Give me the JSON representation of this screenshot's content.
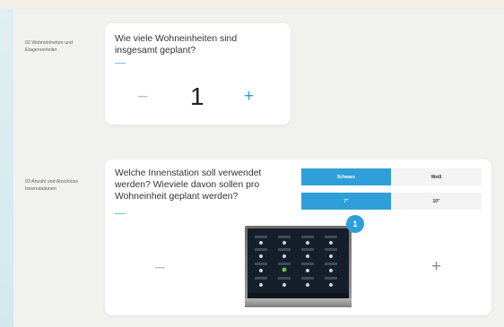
{
  "section1": {
    "label": "02 Wohneinheiten und Etagenverteiler",
    "question": "Wie viele Wohneinheiten sind insgesamt geplant?",
    "value": "1",
    "minus_symbol": "–",
    "plus_symbol": "+"
  },
  "section2": {
    "label": "03 Anzahl und Anschluss Innenstationen",
    "question": "Welche Innenstation soll verwendet werden? Wieviele davon sollen pro Wohneinheit geplant werden?",
    "color_options": [
      "Schwarz",
      "Weiß"
    ],
    "selected_color": "Schwarz",
    "size_options": [
      "7\"",
      "10\""
    ],
    "selected_size": "7\"",
    "badge": "1",
    "minus_symbol": "–",
    "plus_symbol": "+"
  },
  "colors": {
    "accent": "#2e9fd8",
    "background": "#f1f1ee",
    "card": "#ffffff"
  }
}
